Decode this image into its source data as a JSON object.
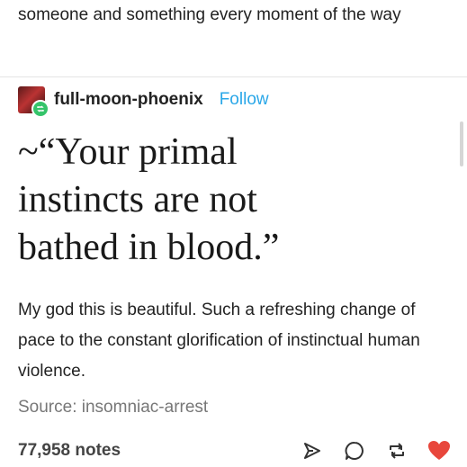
{
  "previous_post": {
    "text": "someone and something every moment of the way"
  },
  "post": {
    "username": "full-moon-phoenix",
    "follow_label": "Follow",
    "quote_lines": [
      "~“Your primal",
      "instincts are not",
      "bathed in blood.”"
    ],
    "body": "My god this is beautiful. Such a refreshing change of pace to the constant glorification of instinctual human violence.",
    "source": "Source: insomniac-arrest",
    "notes": "77,958 notes"
  },
  "colors": {
    "follow": "#2aa7e8",
    "like": "#e8473c",
    "reblog_badge": "#35c46a"
  },
  "icons": [
    "share-icon",
    "reply-icon",
    "reblog-icon",
    "like-icon"
  ]
}
